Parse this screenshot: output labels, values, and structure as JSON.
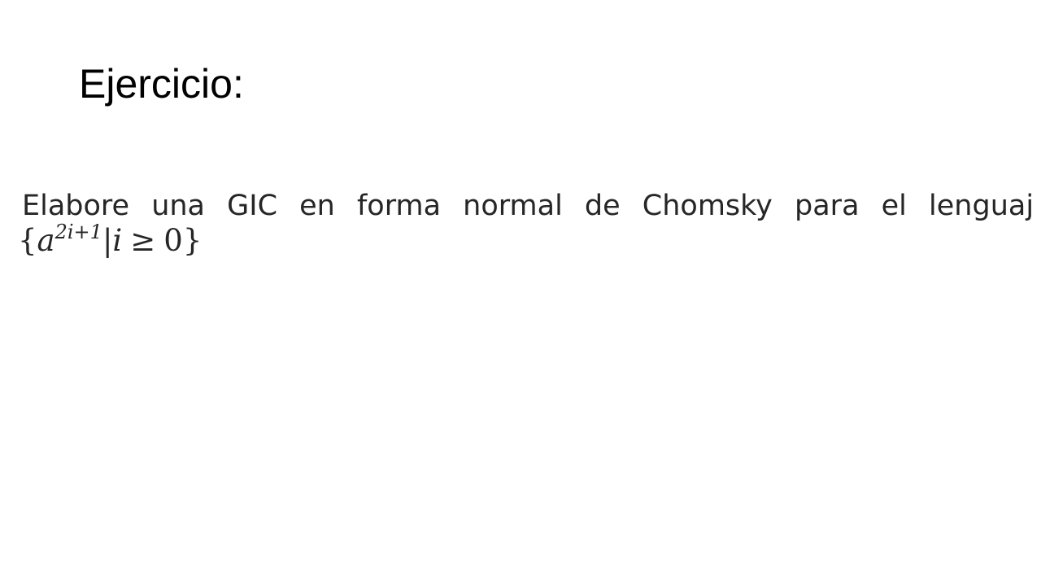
{
  "slide": {
    "title": "Ejercicio:",
    "exercise_text": "Elabore una GIC en forma normal de Chomsky para el lenguaj",
    "formula": {
      "open_brace": "{",
      "base": "a",
      "exponent": "2i+1",
      "separator": "|",
      "variable": "i",
      "relation": "≥",
      "bound": "0",
      "close_brace": "}"
    }
  }
}
